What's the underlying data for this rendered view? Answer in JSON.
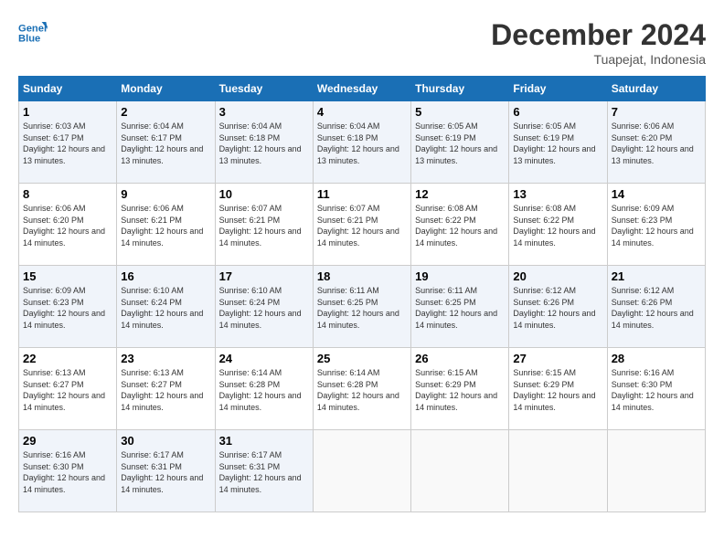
{
  "header": {
    "logo_line1": "General",
    "logo_line2": "Blue",
    "month_year": "December 2024",
    "location": "Tuapejat, Indonesia"
  },
  "days_of_week": [
    "Sunday",
    "Monday",
    "Tuesday",
    "Wednesday",
    "Thursday",
    "Friday",
    "Saturday"
  ],
  "weeks": [
    [
      {
        "day": "1",
        "sunrise": "6:03 AM",
        "sunset": "6:17 PM",
        "daylight": "12 hours and 13 minutes."
      },
      {
        "day": "2",
        "sunrise": "6:04 AM",
        "sunset": "6:17 PM",
        "daylight": "12 hours and 13 minutes."
      },
      {
        "day": "3",
        "sunrise": "6:04 AM",
        "sunset": "6:18 PM",
        "daylight": "12 hours and 13 minutes."
      },
      {
        "day": "4",
        "sunrise": "6:04 AM",
        "sunset": "6:18 PM",
        "daylight": "12 hours and 13 minutes."
      },
      {
        "day": "5",
        "sunrise": "6:05 AM",
        "sunset": "6:19 PM",
        "daylight": "12 hours and 13 minutes."
      },
      {
        "day": "6",
        "sunrise": "6:05 AM",
        "sunset": "6:19 PM",
        "daylight": "12 hours and 13 minutes."
      },
      {
        "day": "7",
        "sunrise": "6:06 AM",
        "sunset": "6:20 PM",
        "daylight": "12 hours and 13 minutes."
      }
    ],
    [
      {
        "day": "8",
        "sunrise": "6:06 AM",
        "sunset": "6:20 PM",
        "daylight": "12 hours and 14 minutes."
      },
      {
        "day": "9",
        "sunrise": "6:06 AM",
        "sunset": "6:21 PM",
        "daylight": "12 hours and 14 minutes."
      },
      {
        "day": "10",
        "sunrise": "6:07 AM",
        "sunset": "6:21 PM",
        "daylight": "12 hours and 14 minutes."
      },
      {
        "day": "11",
        "sunrise": "6:07 AM",
        "sunset": "6:21 PM",
        "daylight": "12 hours and 14 minutes."
      },
      {
        "day": "12",
        "sunrise": "6:08 AM",
        "sunset": "6:22 PM",
        "daylight": "12 hours and 14 minutes."
      },
      {
        "day": "13",
        "sunrise": "6:08 AM",
        "sunset": "6:22 PM",
        "daylight": "12 hours and 14 minutes."
      },
      {
        "day": "14",
        "sunrise": "6:09 AM",
        "sunset": "6:23 PM",
        "daylight": "12 hours and 14 minutes."
      }
    ],
    [
      {
        "day": "15",
        "sunrise": "6:09 AM",
        "sunset": "6:23 PM",
        "daylight": "12 hours and 14 minutes."
      },
      {
        "day": "16",
        "sunrise": "6:10 AM",
        "sunset": "6:24 PM",
        "daylight": "12 hours and 14 minutes."
      },
      {
        "day": "17",
        "sunrise": "6:10 AM",
        "sunset": "6:24 PM",
        "daylight": "12 hours and 14 minutes."
      },
      {
        "day": "18",
        "sunrise": "6:11 AM",
        "sunset": "6:25 PM",
        "daylight": "12 hours and 14 minutes."
      },
      {
        "day": "19",
        "sunrise": "6:11 AM",
        "sunset": "6:25 PM",
        "daylight": "12 hours and 14 minutes."
      },
      {
        "day": "20",
        "sunrise": "6:12 AM",
        "sunset": "6:26 PM",
        "daylight": "12 hours and 14 minutes."
      },
      {
        "day": "21",
        "sunrise": "6:12 AM",
        "sunset": "6:26 PM",
        "daylight": "12 hours and 14 minutes."
      }
    ],
    [
      {
        "day": "22",
        "sunrise": "6:13 AM",
        "sunset": "6:27 PM",
        "daylight": "12 hours and 14 minutes."
      },
      {
        "day": "23",
        "sunrise": "6:13 AM",
        "sunset": "6:27 PM",
        "daylight": "12 hours and 14 minutes."
      },
      {
        "day": "24",
        "sunrise": "6:14 AM",
        "sunset": "6:28 PM",
        "daylight": "12 hours and 14 minutes."
      },
      {
        "day": "25",
        "sunrise": "6:14 AM",
        "sunset": "6:28 PM",
        "daylight": "12 hours and 14 minutes."
      },
      {
        "day": "26",
        "sunrise": "6:15 AM",
        "sunset": "6:29 PM",
        "daylight": "12 hours and 14 minutes."
      },
      {
        "day": "27",
        "sunrise": "6:15 AM",
        "sunset": "6:29 PM",
        "daylight": "12 hours and 14 minutes."
      },
      {
        "day": "28",
        "sunrise": "6:16 AM",
        "sunset": "6:30 PM",
        "daylight": "12 hours and 14 minutes."
      }
    ],
    [
      {
        "day": "29",
        "sunrise": "6:16 AM",
        "sunset": "6:30 PM",
        "daylight": "12 hours and 14 minutes."
      },
      {
        "day": "30",
        "sunrise": "6:17 AM",
        "sunset": "6:31 PM",
        "daylight": "12 hours and 14 minutes."
      },
      {
        "day": "31",
        "sunrise": "6:17 AM",
        "sunset": "6:31 PM",
        "daylight": "12 hours and 14 minutes."
      },
      null,
      null,
      null,
      null
    ]
  ]
}
